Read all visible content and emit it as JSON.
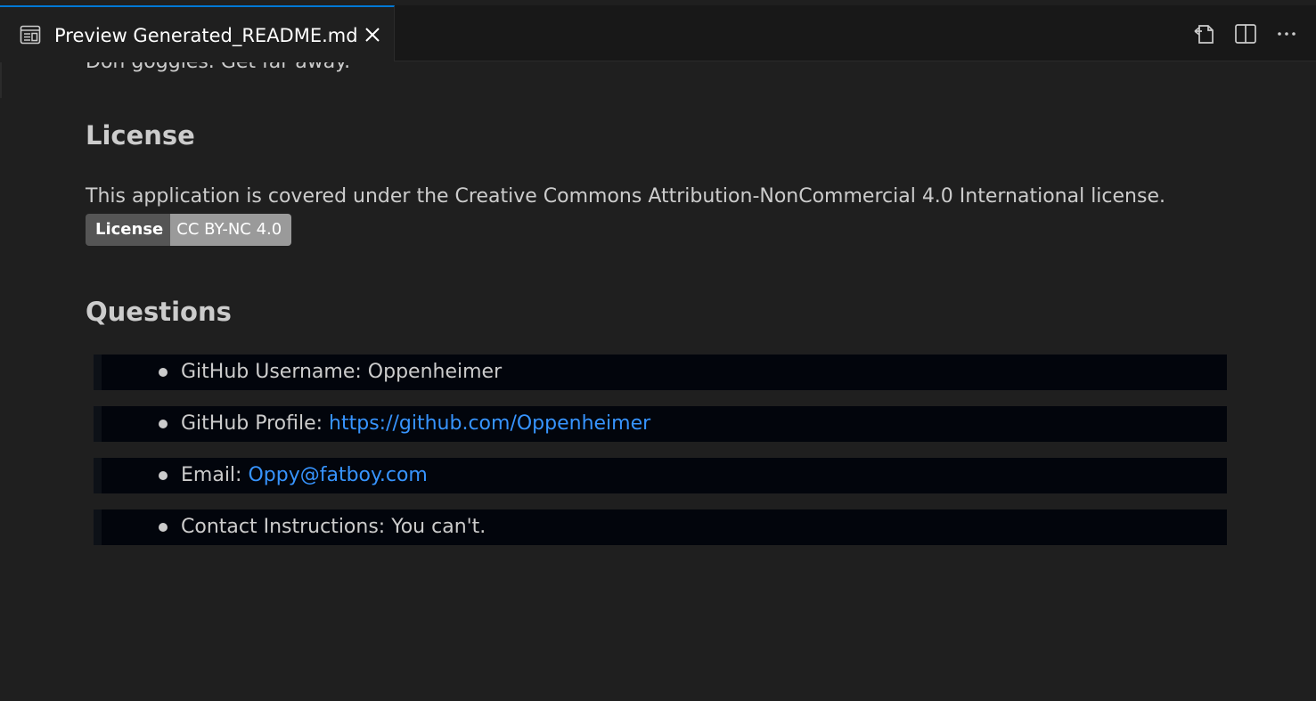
{
  "tab": {
    "title": "Preview Generated_README.md",
    "icon": "preview-icon",
    "close_icon": "close-icon"
  },
  "actions": [
    {
      "name": "open-source-icon"
    },
    {
      "name": "split-editor-icon"
    },
    {
      "name": "more-actions-icon"
    }
  ],
  "content": {
    "partial_line": "Don goggles. Get far away.",
    "license": {
      "heading": "License",
      "text": "This application is covered under the Creative Commons Attribution-NonCommercial 4.0 International license.",
      "badge_label": "License",
      "badge_value": "CC BY-NC 4.0"
    },
    "questions": {
      "heading": "Questions",
      "items": [
        {
          "label": "GitHub Username: ",
          "value": "Oppenheimer",
          "is_link": false
        },
        {
          "label": "GitHub Profile: ",
          "value": "https://github.com/Oppenheimer",
          "is_link": true
        },
        {
          "label": "Email: ",
          "value": "Oppy@fatboy.com",
          "is_link": true
        },
        {
          "label": "Contact Instructions: ",
          "value": "You can't.",
          "is_link": false
        }
      ]
    }
  },
  "colors": {
    "background": "#1f1f1f",
    "tab_accent": "#0078d4",
    "link": "#3794ff",
    "list_item_bg": "#02050c",
    "badge_left": "#555555",
    "badge_right": "#9a9a9a"
  }
}
